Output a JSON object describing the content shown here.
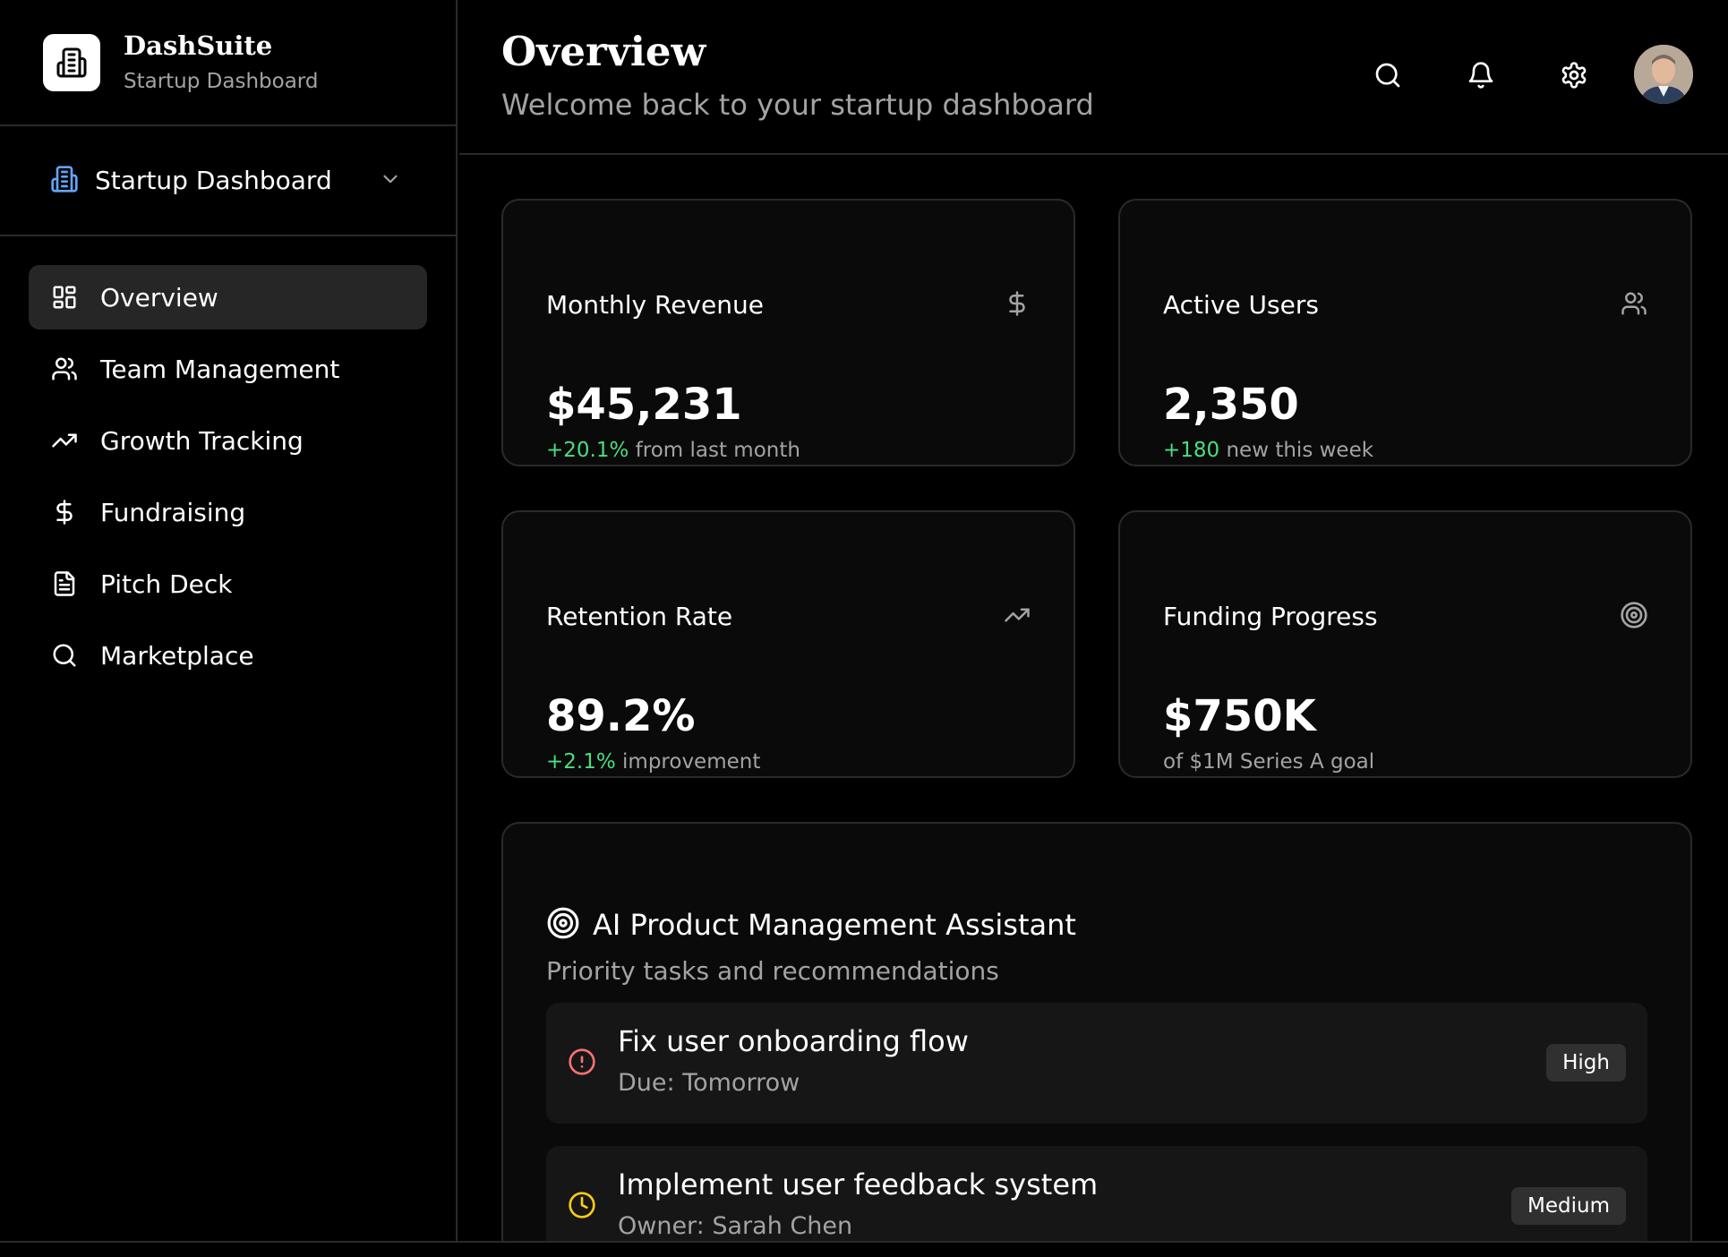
{
  "brand": {
    "name": "DashSuite",
    "subtitle": "Startup Dashboard"
  },
  "workspace": {
    "label": "Startup Dashboard"
  },
  "nav": [
    {
      "label": "Overview",
      "icon": "grid-icon",
      "active": true
    },
    {
      "label": "Team Management",
      "icon": "users-icon"
    },
    {
      "label": "Growth Tracking",
      "icon": "trending-up-icon"
    },
    {
      "label": "Fundraising",
      "icon": "dollar-icon"
    },
    {
      "label": "Pitch Deck",
      "icon": "file-text-icon"
    },
    {
      "label": "Marketplace",
      "icon": "search-icon"
    }
  ],
  "header": {
    "title": "Overview",
    "subtitle": "Welcome back to your startup dashboard",
    "icons": [
      "search-icon",
      "bell-icon",
      "gear-icon",
      "avatar"
    ]
  },
  "cards": [
    {
      "title": "Monthly Revenue",
      "icon": "dollar-icon",
      "value": "$45,231",
      "delta": "+20.1%",
      "note": " from last month"
    },
    {
      "title": "Active Users",
      "icon": "users-icon",
      "value": "2,350",
      "delta": "+180",
      "note": " new this week"
    },
    {
      "title": "Retention Rate",
      "icon": "trending-up-icon",
      "value": "89.2%",
      "delta": "+2.1%",
      "note": " improvement"
    },
    {
      "title": "Funding Progress",
      "icon": "target-icon",
      "value": "$750K",
      "delta": "",
      "note": "of $1M Series A goal"
    }
  ],
  "assistant": {
    "title": "AI Product Management Assistant",
    "subtitle": "Priority tasks and recommendations",
    "tasks": [
      {
        "title": "Fix user onboarding flow",
        "meta": "Due: Tomorrow",
        "priority": "High",
        "icon": "alert-circle-icon",
        "color": "#f87171"
      },
      {
        "title": "Implement user feedback system",
        "meta": "Owner: Sarah Chen",
        "priority": "Medium",
        "icon": "clock-icon",
        "color": "#facc15"
      }
    ]
  },
  "colors": {
    "positive": "#4ade80",
    "accent_blue": "#60a5fa"
  }
}
